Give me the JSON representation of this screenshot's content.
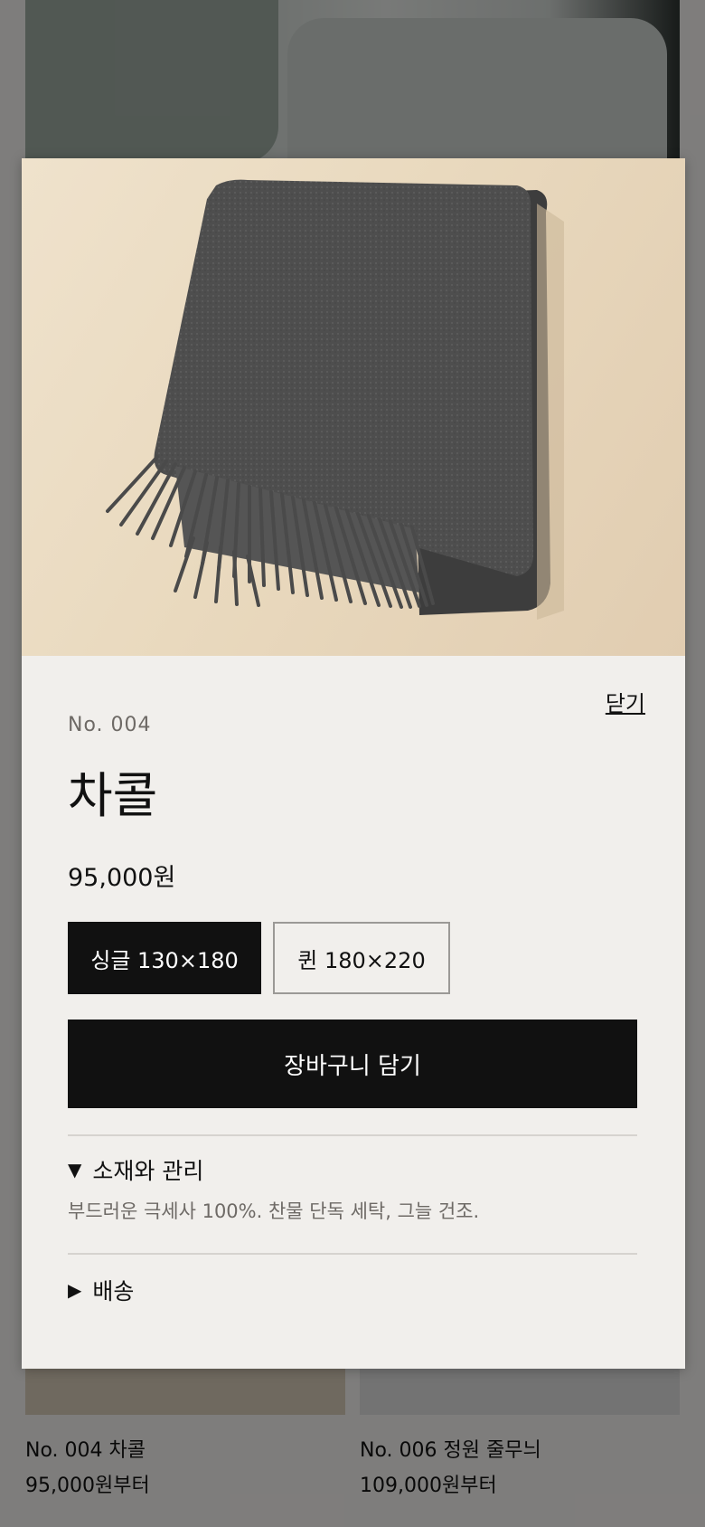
{
  "modal": {
    "close_label": "닫기",
    "product_no": "No. 004",
    "product_name": "차콜",
    "price": "95,000원",
    "sizes": [
      {
        "label": "싱글 130×180",
        "selected": true
      },
      {
        "label": "퀸 180×220",
        "selected": false
      }
    ],
    "add_to_cart_label": "장바구니 담기",
    "accordion": [
      {
        "icon": "triangle-down-icon",
        "glyph": "▼",
        "title": "소재와 관리",
        "expanded": true,
        "body": "부드러운 극세사 100%. 찬물 단독 세탁, 그늘 건조."
      },
      {
        "icon": "triangle-right-icon",
        "glyph": "▶",
        "title": "배송",
        "expanded": false
      }
    ]
  },
  "background_grid": [
    {
      "title": "No. 004 차콜",
      "price": "95,000원부터"
    },
    {
      "title": "No. 006 정원 줄무늬",
      "price": "109,000원부터"
    }
  ],
  "colors": {
    "backdrop": "#7f7f7f",
    "modal_bg": "#f1efec",
    "primary": "#111111",
    "muted_text": "#6e6a66",
    "product_bg": "#e9d9be",
    "blanket": "#4f4f4f"
  }
}
